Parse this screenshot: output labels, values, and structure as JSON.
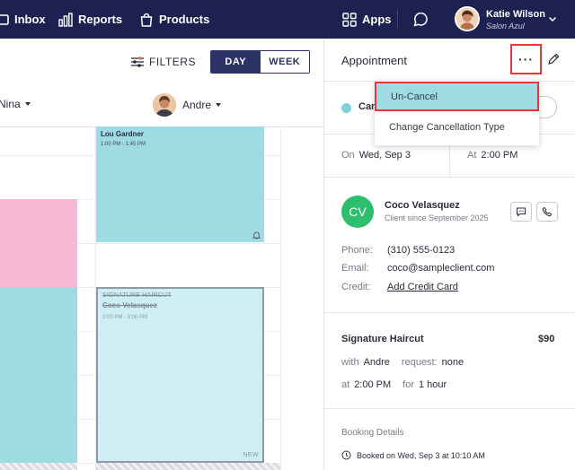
{
  "nav": {
    "inbox": "Inbox",
    "reports": "Reports",
    "products": "Products",
    "apps": "Apps",
    "user_name": "Katie Wilson",
    "salon": "Salon Azul"
  },
  "calendar": {
    "filters": "FILTERS",
    "view_day": "DAY",
    "view_week": "WEEK",
    "staff_1": "Nina",
    "staff_2": "Andre",
    "appt_1": {
      "name": "Lou Gardner",
      "time": "1:00 PM - 1:45 PM"
    },
    "appt_2": {
      "service": "SIGNATURE HAIRCUT",
      "name": "Coco Velasquez",
      "time": "2:00 PM - 3:00 PM",
      "tag": "NEW"
    }
  },
  "panel": {
    "title": "Appointment",
    "more": "···",
    "status": "Can",
    "on_label": "On",
    "on_value": "Wed, Sep 3",
    "at_label": "At",
    "at_value": "2:00 PM",
    "client_initials": "CV",
    "client_name": "Coco Velasquez",
    "client_since": "Client since September 2025",
    "phone_label": "Phone:",
    "phone": "(310) 555-0123",
    "email_label": "Email:",
    "email": "coco@sampleclient.com",
    "credit_label": "Credit:",
    "credit": "Add Credit Card",
    "service": "Signature Haircut",
    "price": "$90",
    "with_label": "with",
    "with_value": "Andre",
    "request_label": "request:",
    "request_value": "none",
    "at2_label": "at",
    "at2_value": "2:00 PM",
    "for_label": "for",
    "for_value": "1 hour",
    "booking_title": "Booking Details",
    "booked_on": "Booked on Wed, Sep 3 at 10:10 AM"
  },
  "menu": {
    "uncancel": "Un-Cancel",
    "change_type": "Change Cancellation Type"
  },
  "colors": {
    "nav_bg": "#1c2150",
    "teal": "#9fdbe2",
    "pink": "#f6b8d3",
    "highlight_border": "#e53935",
    "client_avatar": "#2dbf6d"
  }
}
